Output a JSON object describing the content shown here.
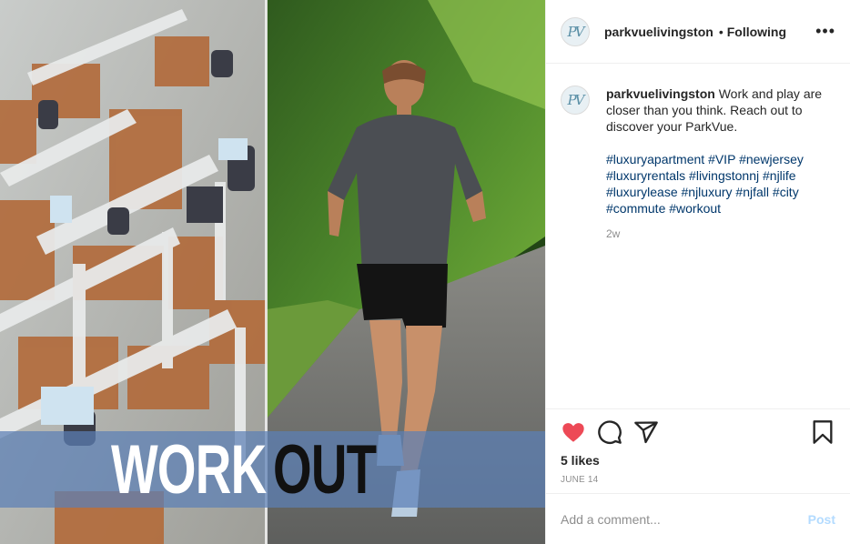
{
  "post": {
    "username": "parkvuelivingston",
    "separator": "•",
    "follow_status": "Following",
    "more_label": "•••",
    "avatar_monogram": "PV"
  },
  "media": {
    "overlay_left": "WORK",
    "overlay_right": "OUT"
  },
  "caption": {
    "username": "parkvuelivingston",
    "text": "Work and play are closer than you think. Reach out to discover your ParkVue.",
    "hashtags": [
      "#luxuryapartment",
      "#VIP",
      "#newjersey",
      "#luxuryrentals",
      "#livingstonnj",
      "#njlife",
      "#luxurylease",
      "#njluxury",
      "#njfall",
      "#city",
      "#commute",
      "#workout"
    ],
    "age": "2w"
  },
  "actions": {
    "icons": [
      "heart-filled-icon",
      "comment-icon",
      "share-icon",
      "bookmark-icon"
    ],
    "likes": "5 likes",
    "date": "JUNE 14",
    "heart_color": "#ed4956"
  },
  "comment_box": {
    "placeholder": "Add a comment...",
    "post_label": "Post"
  }
}
